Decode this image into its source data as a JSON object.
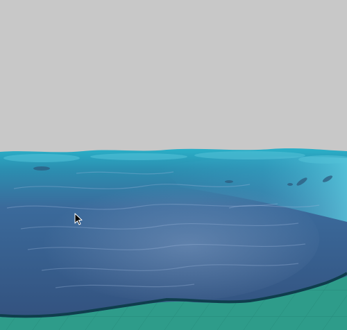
{
  "viewport": {
    "background_color": "#c8c8c8"
  },
  "scene": {
    "kind": "ocean-water-simulation",
    "water": {
      "foam_color": "#2ab0c8",
      "surface_color": "#3a8fb4",
      "deep_color": "#33527f",
      "rim_color": "#0f3e4d"
    },
    "ground": {
      "color": "#2e9c8a",
      "grid_color": "#1f7f70"
    }
  },
  "cursor": {
    "icon": "mouse-pointer-icon"
  }
}
